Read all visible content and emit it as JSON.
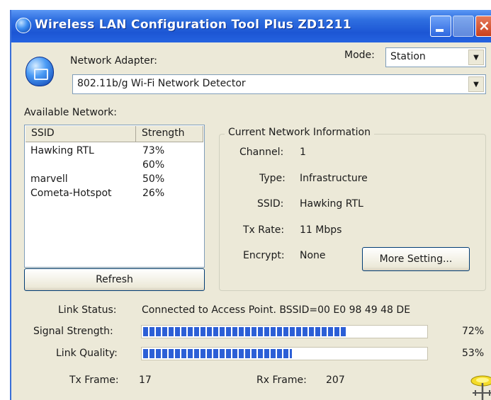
{
  "window": {
    "title": "Wireless LAN Configuration Tool Plus   ZD1211"
  },
  "adapter": {
    "label": "Network Adapter:",
    "value": "802.11b/g Wi-Fi Network Detector"
  },
  "mode": {
    "label": "Mode:",
    "value": "Station"
  },
  "available": {
    "label": "Available Network:",
    "columns": [
      "SSID",
      "Strength"
    ],
    "rows": [
      {
        "ssid": "Hawking RTL",
        "strength": "73%"
      },
      {
        "ssid": "",
        "strength": "60%"
      },
      {
        "ssid": "marvell",
        "strength": "50%"
      },
      {
        "ssid": "Cometa-Hotspot",
        "strength": "26%"
      }
    ],
    "refresh_label": "Refresh"
  },
  "current": {
    "title": "Current Network Information",
    "channel_label": "Channel:",
    "channel": "1",
    "type_label": "Type:",
    "type": "Infrastructure",
    "ssid_label": "SSID:",
    "ssid": "Hawking RTL",
    "txrate_label": "Tx Rate:",
    "txrate": "11 Mbps",
    "encrypt_label": "Encrypt:",
    "encrypt": "None",
    "more_label": "More Setting..."
  },
  "status": {
    "link_label": "Link Status:",
    "link_value": "Connected to Access Point. BSSID=00 E0 98 49 48 DE",
    "signal_label": "Signal Strength:",
    "signal_value": "72%",
    "signal_fraction": 0.72,
    "quality_label": "Link Quality:",
    "quality_value": "53%",
    "quality_fraction": 0.53,
    "tx_label": "Tx Frame:",
    "tx_value": "17",
    "rx_label": "Rx Frame:",
    "rx_value": "207"
  },
  "icons": {
    "title": "wireless-globe-icon",
    "adapter": "network-adapter-icon",
    "antenna": "antenna-signal-icon",
    "dropdown": "chevron-down-icon"
  },
  "colors": {
    "title_bar": "#2563e0",
    "progress_fill": "#2c5fd6",
    "window_bg": "#ece9d8"
  }
}
